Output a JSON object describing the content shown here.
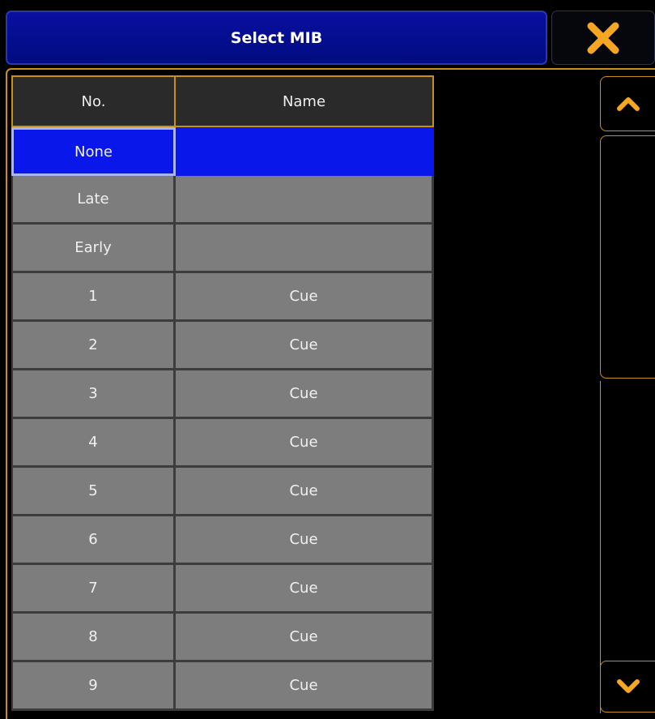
{
  "dialog": {
    "title": "Select MIB",
    "close_icon": "close-x-icon",
    "accent": "#f5a623"
  },
  "table": {
    "columns": [
      "No.",
      "Name"
    ],
    "rows": [
      {
        "no": "None",
        "name": ""
      },
      {
        "no": "Late",
        "name": ""
      },
      {
        "no": "Early",
        "name": ""
      },
      {
        "no": "1",
        "name": "Cue"
      },
      {
        "no": "2",
        "name": "Cue"
      },
      {
        "no": "3",
        "name": "Cue"
      },
      {
        "no": "4",
        "name": "Cue"
      },
      {
        "no": "5",
        "name": "Cue"
      },
      {
        "no": "6",
        "name": "Cue"
      },
      {
        "no": "7",
        "name": "Cue"
      },
      {
        "no": "8",
        "name": "Cue"
      },
      {
        "no": "9",
        "name": "Cue"
      }
    ],
    "selected_row": "None"
  },
  "scrollbar": {
    "up_icon": "chevron-up-icon",
    "down_icon": "chevron-down-icon"
  }
}
